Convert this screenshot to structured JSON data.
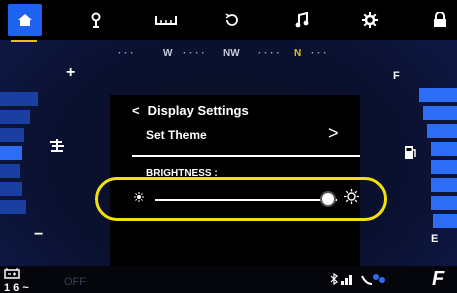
{
  "topbar": {
    "icons": [
      "home-icon",
      "location-pin-icon",
      "tire-icon",
      "sync-icon",
      "music-icon",
      "gear-icon",
      "lock-icon"
    ]
  },
  "compass": {
    "labels": [
      "W",
      "NW",
      "N"
    ],
    "accent": "#e2c21a"
  },
  "gauges": {
    "fuel_full_label": "F",
    "fuel_empty_label": "E",
    "temp_plus_label": "+",
    "temp_minus_label": "−"
  },
  "panel": {
    "back_label": "<",
    "title": "Display Settings",
    "theme_label": "Set Theme",
    "theme_arrow": ">",
    "brightness_label": "BRIGHTNESS :",
    "brightness_level": 0.95
  },
  "status": {
    "range": "1 6 ~",
    "left_icon": "battery-icon",
    "off_label": "OFF",
    "right_icons": [
      "bluetooth-icon",
      "signal-icon",
      "phone-icon"
    ],
    "gear": "F"
  },
  "colors": {
    "highlight": "#f2e20a",
    "accent_blue": "#1e63f0"
  }
}
